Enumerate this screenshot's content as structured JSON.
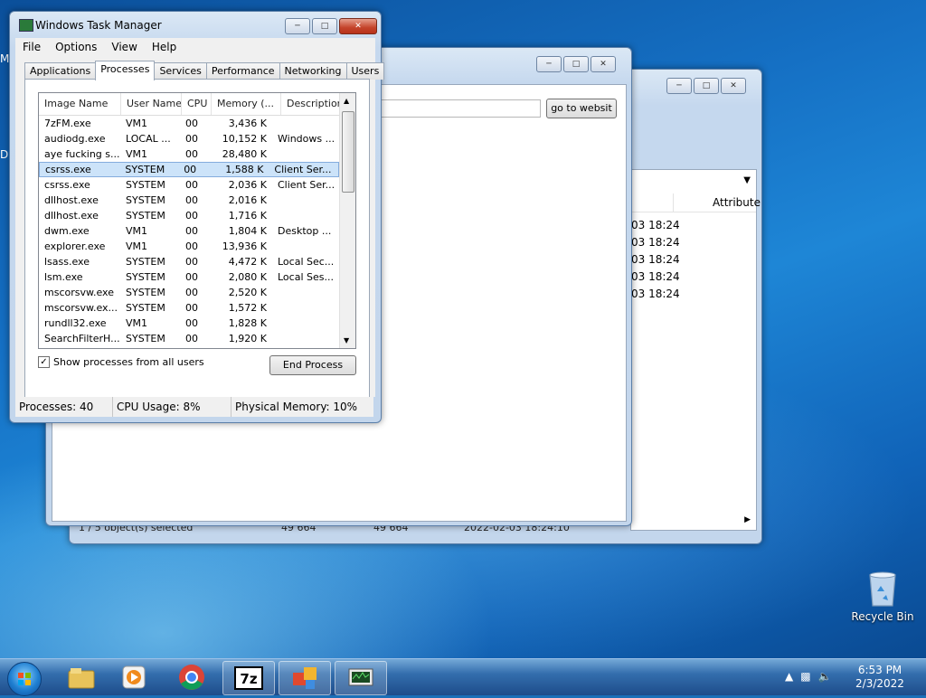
{
  "desktop": {
    "edge_letters": [
      "M",
      "D"
    ],
    "recycle_bin_label": "Recycle Bin"
  },
  "explorer_back": {
    "header": "Attribute",
    "times": [
      "03 18:24",
      "03 18:24",
      "03 18:24",
      "03 18:24",
      "03 18:24"
    ],
    "status": {
      "selected": "1 / 5 object(s) selected",
      "size1": "49 664",
      "size2": "49 664",
      "date": "2022-02-03 18:24:10"
    }
  },
  "browser_window": {
    "go_button": "go to websit"
  },
  "task_manager": {
    "title": "Windows Task Manager",
    "menu": [
      "File",
      "Options",
      "View",
      "Help"
    ],
    "tabs": [
      "Applications",
      "Processes",
      "Services",
      "Performance",
      "Networking",
      "Users"
    ],
    "active_tab": "Processes",
    "columns": [
      "Image Name",
      "User Name",
      "CPU",
      "Memory (...",
      "Description"
    ],
    "rows": [
      {
        "name": "7zFM.exe",
        "user": "VM1",
        "cpu": "00",
        "mem": "3,436 K",
        "desc": ""
      },
      {
        "name": "audiodg.exe",
        "user": "LOCAL ...",
        "cpu": "00",
        "mem": "10,152 K",
        "desc": "Windows ..."
      },
      {
        "name": "aye fucking s...",
        "user": "VM1",
        "cpu": "00",
        "mem": "28,480 K",
        "desc": ""
      },
      {
        "name": "csrss.exe",
        "user": "SYSTEM",
        "cpu": "00",
        "mem": "1,588 K",
        "desc": "Client Ser..."
      },
      {
        "name": "csrss.exe",
        "user": "SYSTEM",
        "cpu": "00",
        "mem": "2,036 K",
        "desc": "Client Ser..."
      },
      {
        "name": "dllhost.exe",
        "user": "SYSTEM",
        "cpu": "00",
        "mem": "2,016 K",
        "desc": ""
      },
      {
        "name": "dllhost.exe",
        "user": "SYSTEM",
        "cpu": "00",
        "mem": "1,716 K",
        "desc": ""
      },
      {
        "name": "dwm.exe",
        "user": "VM1",
        "cpu": "00",
        "mem": "1,804 K",
        "desc": "Desktop ..."
      },
      {
        "name": "explorer.exe",
        "user": "VM1",
        "cpu": "00",
        "mem": "13,936 K",
        "desc": ""
      },
      {
        "name": "lsass.exe",
        "user": "SYSTEM",
        "cpu": "00",
        "mem": "4,472 K",
        "desc": "Local Sec..."
      },
      {
        "name": "lsm.exe",
        "user": "SYSTEM",
        "cpu": "00",
        "mem": "2,080 K",
        "desc": "Local Ses..."
      },
      {
        "name": "mscorsvw.exe",
        "user": "SYSTEM",
        "cpu": "00",
        "mem": "2,520 K",
        "desc": ""
      },
      {
        "name": "mscorsvw.ex...",
        "user": "SYSTEM",
        "cpu": "00",
        "mem": "1,572 K",
        "desc": ""
      },
      {
        "name": "rundll32.exe",
        "user": "VM1",
        "cpu": "00",
        "mem": "1,828 K",
        "desc": ""
      },
      {
        "name": "SearchFilterH...",
        "user": "SYSTEM",
        "cpu": "00",
        "mem": "1,920 K",
        "desc": ""
      }
    ],
    "selected_row": 3,
    "show_all_label": "Show processes from all users",
    "show_all_checked": true,
    "end_process_label": "End Process",
    "status": {
      "processes": "Processes: 40",
      "cpu": "CPU Usage: 8%",
      "memory": "Physical Memory: 10%"
    }
  },
  "taskbar": {
    "pinned": [
      "windows-explorer-icon",
      "media-player-icon",
      "chrome-icon",
      "7zip-icon",
      "office-app-icon",
      "task-manager-icon"
    ],
    "time": "6:53 PM",
    "date": "2/3/2022"
  }
}
